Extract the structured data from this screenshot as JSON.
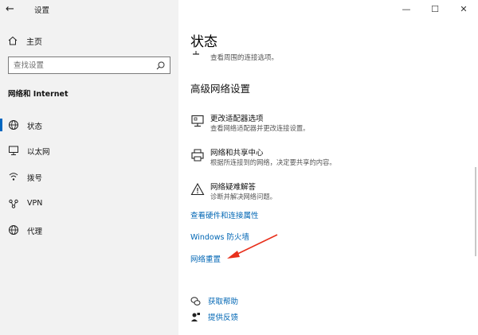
{
  "app": {
    "title": "设置"
  },
  "sidebar": {
    "home_label": "主页",
    "search_placeholder": "查找设置",
    "section_title": "网络和 Internet",
    "items": [
      {
        "label": "状态",
        "icon": "globe-status-icon",
        "active": true
      },
      {
        "label": "以太网",
        "icon": "ethernet-icon"
      },
      {
        "label": "拨号",
        "icon": "dialup-icon"
      },
      {
        "label": "VPN",
        "icon": "vpn-icon"
      },
      {
        "label": "代理",
        "icon": "globe-icon"
      }
    ]
  },
  "window_controls": {
    "minimize": "—",
    "maximize": "☐",
    "close": "✕"
  },
  "main": {
    "title": "状态",
    "partial_desc": "查看周围的连接选项。",
    "section_heading": "高级网络设置",
    "options": [
      {
        "title": "更改适配器选项",
        "desc": "查看网络适配器并更改连接设置。",
        "icon": "monitor-icon"
      },
      {
        "title": "网络和共享中心",
        "desc": "根据所连接到的网络，决定要共享的内容。",
        "icon": "printer-icon"
      },
      {
        "title": "网络疑难解答",
        "desc": "诊断并解决网络问题。",
        "icon": "warning-icon"
      }
    ],
    "links": {
      "hardware": "查看硬件和连接属性",
      "firewall": "Windows 防火墙",
      "reset": "网络重置"
    },
    "help": {
      "get_help": "获取帮助",
      "feedback": "提供反馈"
    }
  },
  "colors": {
    "accent": "#0067c0",
    "link": "#0066b4",
    "arrow": "#e8301c",
    "sidebar_bg": "#f2f2f2"
  }
}
